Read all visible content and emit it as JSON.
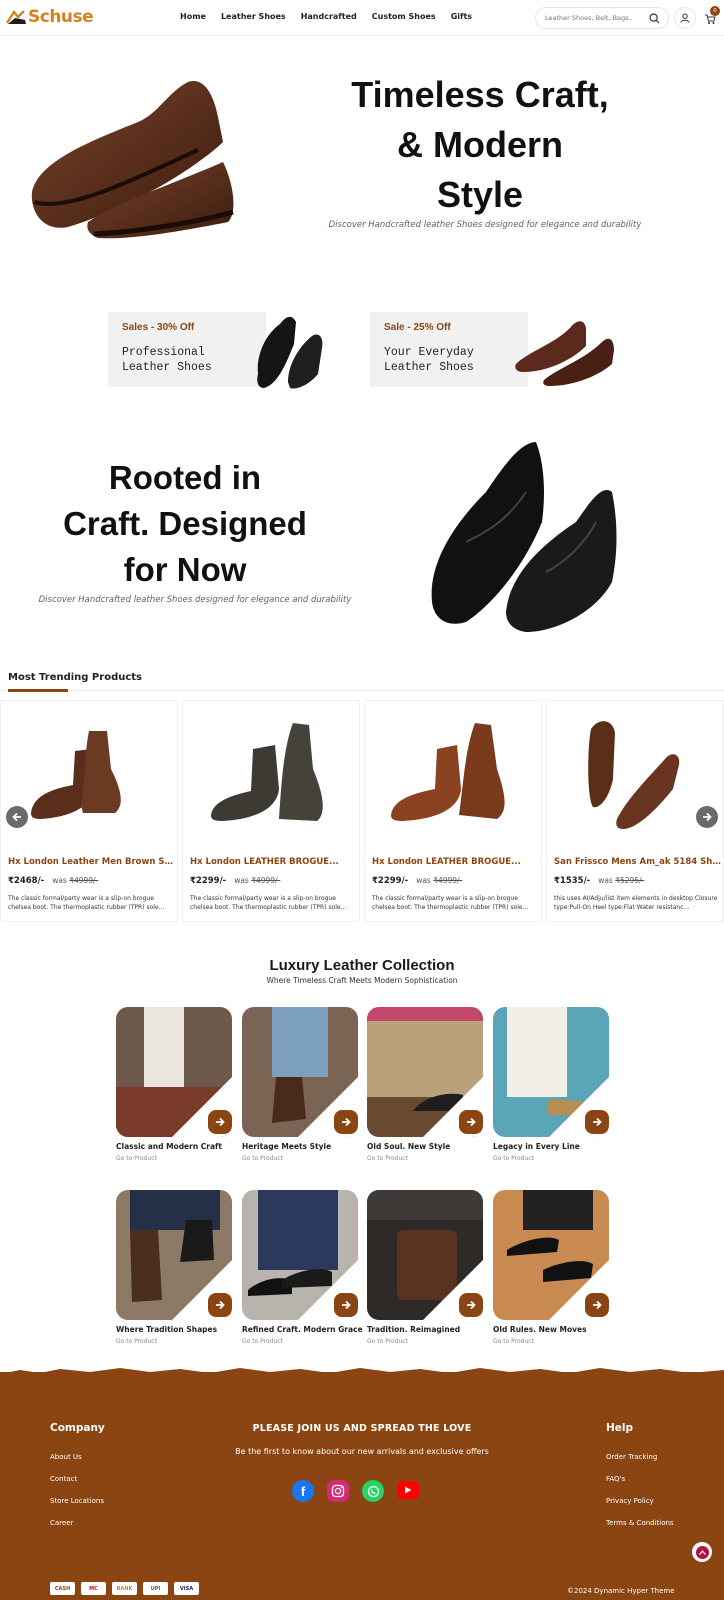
{
  "header": {
    "brand": "Schuse",
    "nav": [
      "Home",
      "Leather Shoes",
      "Handcrafted",
      "Custom Shoes",
      "Gifts"
    ],
    "search_placeholder": "Leather Shoes, Belt, Bags..",
    "cart_count": "0"
  },
  "hero": {
    "title_line1": "Timeless Craft,",
    "title_line2": "& Modern",
    "title_line3": "Style",
    "subtitle": "Discover Handcrafted leather Shoes designed for elegance and durability"
  },
  "promos": [
    {
      "tag": "Sales - 30% Off",
      "line1": "Professional",
      "line2": "Leather Shoes"
    },
    {
      "tag": "Sale - 25% Off",
      "line1": "Your Everyday",
      "line2": "Leather Shoes"
    }
  ],
  "rooted": {
    "line1": "Rooted in",
    "line2": "Craft. Designed",
    "line3": "for Now",
    "subtitle": "Discover Handcrafted leather Shoes designed for elegance and durability"
  },
  "trending": {
    "title": "Most Trending Products",
    "products": [
      {
        "name": "Hx London Leather Men Brown Sturd...",
        "price": "₹2468/-",
        "was_label": "was",
        "was": "₹4999/-",
        "desc": "The classic formal/party wear is a slip-on brogue chelsea boot. The thermoplastic rubber (TPR) sole..."
      },
      {
        "name": "Hx London LEATHER BROGUE...",
        "price": "₹2299/-",
        "was_label": "was",
        "was": "₹4999/-",
        "desc": "The classic formal/party wear is a slip-on brogue chelsea boot. The thermoplastic rubber (TPR) sole..."
      },
      {
        "name": "Hx London LEATHER BROGUE...",
        "price": "₹2299/-",
        "was_label": "was",
        "was": "₹4999/-",
        "desc": "The classic formal/party wear is a slip-on brogue chelsea boot. The thermoplastic rubber (TPR) sole..."
      },
      {
        "name": "San Frissco Mens Am_ak 5184 Shoes -...",
        "price": "₹1535/-",
        "was_label": "was",
        "was": "₹5295/-",
        "desc": "this uses AI/Adju/list item elements in desktop Closure type:Pull-On Heel type:Flat Water resistanc..."
      }
    ]
  },
  "collection": {
    "title": "Luxury Leather Collection",
    "subtitle": "Where Timeless Craft Meets Modern Sophistication",
    "link_label": "Go to Product",
    "items": [
      {
        "label": "Classic and Modern Craft",
        "color": "#6d5a4a"
      },
      {
        "label": "Heritage Meets Style",
        "color": "#7a6453"
      },
      {
        "label": "Old Soul. New Style",
        "color": "#b9a27a"
      },
      {
        "label": "Legacy in Every Line",
        "color": "#5aa6b8"
      },
      {
        "label": "Where Tradition Shapes",
        "color": "#8c7a66"
      },
      {
        "label": "Refined Craft. Modern Grace",
        "color": "#b9b3ad"
      },
      {
        "label": "Tradition. Reimagined",
        "color": "#2e2a28"
      },
      {
        "label": "Old Rules. New Moves",
        "color": "#c98a52"
      }
    ]
  },
  "footer": {
    "company_title": "Company",
    "company_links": [
      "About Us",
      "Contact",
      "Store Locations",
      "Career"
    ],
    "join_title": "PLEASE JOIN US AND SPREAD THE LOVE",
    "join_sub": "Be the first to know about our new arrivals and exclusive offers",
    "help_title": "Help",
    "help_links": [
      "Order Tracking",
      "FAQ's",
      "Privacy Policy",
      "Terms & Conditions"
    ],
    "payments": [
      "CASH",
      "MC",
      "BANK",
      "UPI",
      "VISA"
    ],
    "copyright": "©2024 Dynamic Hyper Theme",
    "colors": {
      "brown": "#8b4513"
    }
  }
}
